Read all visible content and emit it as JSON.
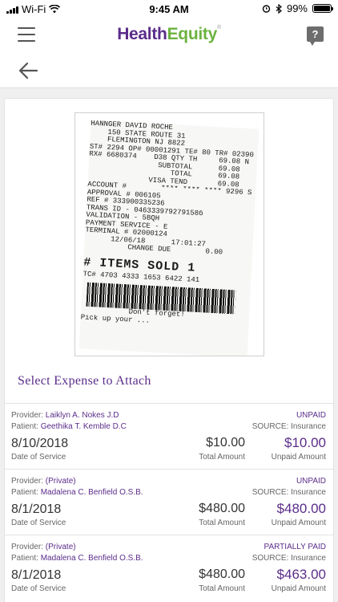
{
  "status_bar": {
    "carrier": "Wi-Fi",
    "time": "9:45 AM",
    "battery": "99%",
    "battery_level": 0.99,
    "icons": [
      "signal-icon",
      "wifi-icon",
      "alarm-icon",
      "bluetooth-icon",
      "battery-icon"
    ]
  },
  "header": {
    "logo_health": "Health",
    "logo_equity": "Equity",
    "logo_tm": "®",
    "help_label": "?",
    "icons": [
      "menu-icon",
      "help-icon",
      "back-arrow-icon"
    ]
  },
  "receipt": {
    "lines": [
      "HANNGER DAVID ROCHE",
      "    150 STATE ROUTE 31",
      "    FLEMINGTON NJ 8822",
      "ST# 2294 OP# 00001291 TE# 80 TR# 02390",
      "RX# 6680374    D38 QTY TH     69.08 N",
      "                SUBTOTAL      69.08",
      "                   TOTAL      69.08",
      "              VISA TEND       69.08",
      "ACCOUNT #        **** **** **** 9296 S",
      "APPROVAL # 006105",
      "REF # 333900335236",
      "TRANS ID - 046333979279158б",
      "VALIDATION - 5BQH",
      "PAYMENT SERVICE - E",
      "TERMINAL # 02000124",
      "",
      "      12/06/18      17:01:27",
      "",
      "          CHANGE DUE        0.00"
    ],
    "items_sold": "# ITEMS SOLD 1",
    "tc_line": "TC# 4703 4333 1653 6422 141",
    "footer_1": "           Don't forget!",
    "footer_2": "Pick up your ..."
  },
  "section_title": "Select Expense to Attach",
  "labels": {
    "provider": "Provider: ",
    "patient": "Patient: ",
    "date_of_service": "Date of Service",
    "total_amount": "Total Amount",
    "unpaid_amount": "Unpaid Amount"
  },
  "expenses": [
    {
      "provider": "Laiklyn A. Nokes J.D",
      "patient": "Geethika T. Kemble D.C",
      "status": "UNPAID",
      "source": "SOURCE: Insurance",
      "date": "8/10/2018",
      "total": "$10.00",
      "unpaid": "$10.00"
    },
    {
      "provider": "(Private)",
      "patient": "Madalena C. Benfield O.S.B.",
      "status": "UNPAID",
      "source": "SOURCE: Insurance",
      "date": "8/1/2018",
      "total": "$480.00",
      "unpaid": "$480.00"
    },
    {
      "provider": "(Private)",
      "patient": "Madalena C. Benfield O.S.B.",
      "status": "PARTIALLY PAID",
      "source": "SOURCE: Insurance",
      "date": "8/1/2018",
      "total": "$480.00",
      "unpaid": "$463.00"
    }
  ],
  "colors": {
    "brand_purple": "#5b2d8a",
    "brand_green": "#6cb33f",
    "background_gray": "#efefef"
  }
}
